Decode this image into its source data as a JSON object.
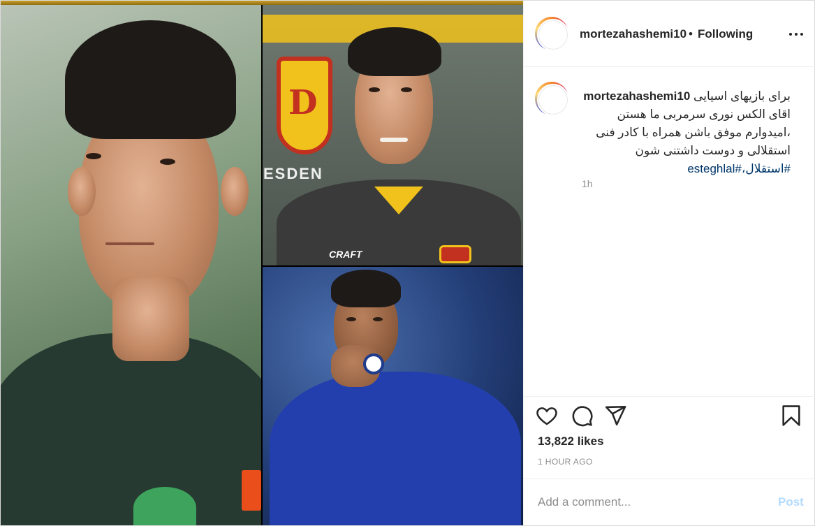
{
  "header": {
    "username": "mortezahashemi10",
    "separator": "•",
    "follow_state": "Following",
    "more_icon": "more-horizontal-icon"
  },
  "caption": {
    "username": "mortezahashemi10",
    "line1": "برای بازیهای اسیایی",
    "line2": "اقای الکس نوری سرمربی ما هستن",
    "line3": "،امیدوارم موفق باشن همراه با کادر فنی",
    "line4": "استقلالی و دوست داشتنی شون",
    "hashtags": "#استقلال،#esteghlal",
    "time": "1h"
  },
  "media": {
    "kit_brand": "CRAFT",
    "wall_text": "ESDEN",
    "badge_letter": "D"
  },
  "actions": {
    "like_icon": "heart-icon",
    "comment_icon": "comment-icon",
    "share_icon": "share-icon",
    "save_icon": "bookmark-icon",
    "likes": "13,822 likes",
    "posted_ago": "1 HOUR AGO"
  },
  "comment": {
    "placeholder": "Add a comment...",
    "post_label": "Post"
  },
  "colors": {
    "link": "#00376b",
    "muted": "#8e8e8e",
    "post_disabled": "#b3dbff"
  }
}
